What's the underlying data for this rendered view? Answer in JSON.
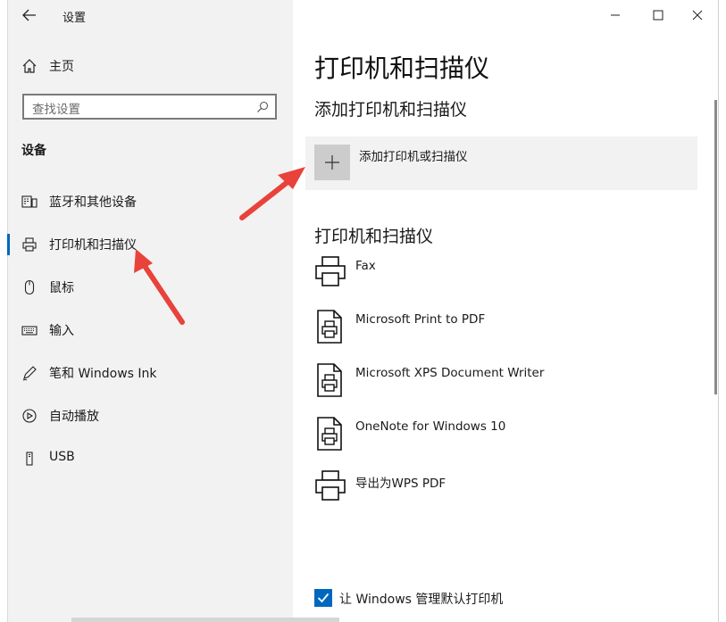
{
  "window": {
    "title": "设置",
    "controls": {
      "minimize": "—",
      "maximize": "☐",
      "close": "✕"
    }
  },
  "sidebar": {
    "home_label": "主页",
    "search_placeholder": "查找设置",
    "section_title": "设备",
    "items": [
      {
        "label": "蓝牙和其他设备",
        "icon": "bluetooth-devices-icon",
        "active": false
      },
      {
        "label": "打印机和扫描仪",
        "icon": "printer-icon",
        "active": true
      },
      {
        "label": "鼠标",
        "icon": "mouse-icon",
        "active": false
      },
      {
        "label": "输入",
        "icon": "keyboard-icon",
        "active": false
      },
      {
        "label": "笔和 Windows Ink",
        "icon": "pen-icon",
        "active": false
      },
      {
        "label": "自动播放",
        "icon": "autoplay-icon",
        "active": false
      },
      {
        "label": "USB",
        "icon": "usb-icon",
        "active": false
      }
    ]
  },
  "main": {
    "page_title": "打印机和扫描仪",
    "add_section_title": "添加打印机和扫描仪",
    "add_button_label": "添加打印机或扫描仪",
    "list_section_title": "打印机和扫描仪",
    "printers": [
      {
        "name": "Fax",
        "icon": "fax-printer-icon"
      },
      {
        "name": "Microsoft Print to PDF",
        "icon": "document-printer-icon"
      },
      {
        "name": "Microsoft XPS Document Writer",
        "icon": "document-printer-icon"
      },
      {
        "name": "OneNote for Windows 10",
        "icon": "document-printer-icon"
      },
      {
        "name": "导出为WPS PDF",
        "icon": "printer-icon"
      }
    ],
    "default_printer_checkbox": {
      "label": "让 Windows 管理默认打印机",
      "checked": true
    }
  },
  "colors": {
    "accent": "#0067c0",
    "annotation_arrow": "#e8423b",
    "sidebar_bg": "#f2f2f2"
  }
}
